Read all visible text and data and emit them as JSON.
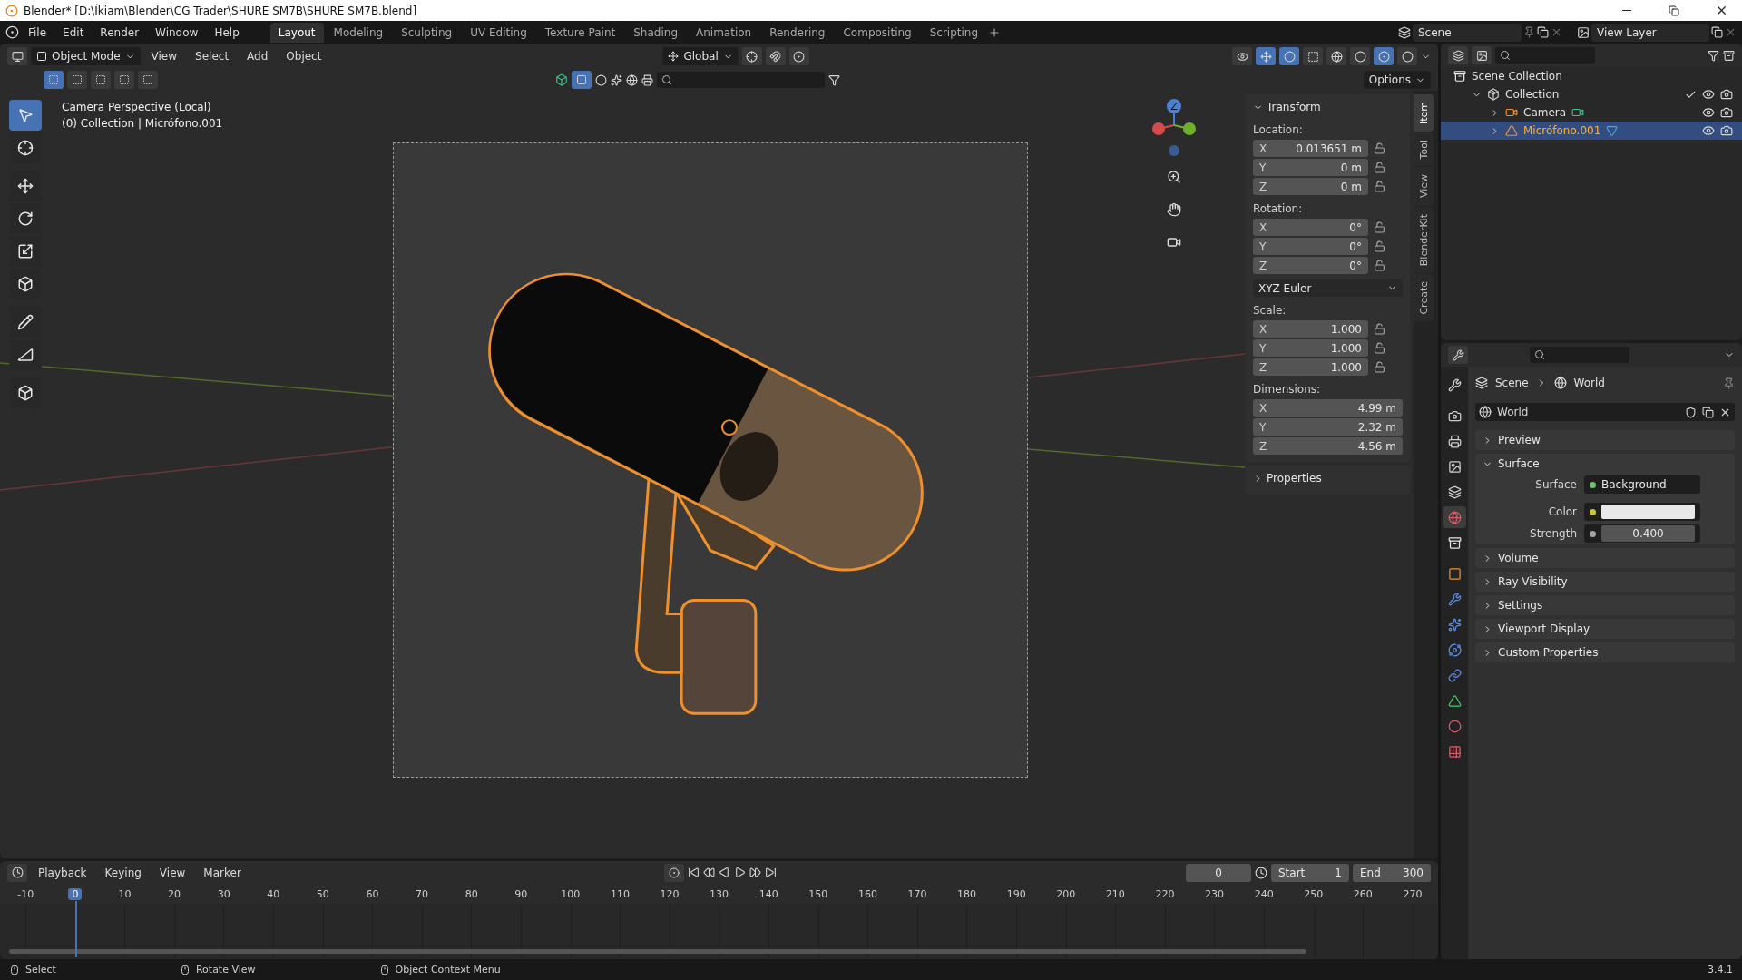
{
  "window": {
    "title": "Blender* [D:\\Íkiam\\Blender\\CG Trader\\SHURE SM7B\\SHURE SM7B.blend]"
  },
  "menu": [
    "File",
    "Edit",
    "Render",
    "Window",
    "Help"
  ],
  "workspaces": [
    {
      "label": "Layout",
      "selected": true
    },
    {
      "label": "Modeling",
      "selected": false
    },
    {
      "label": "Sculpting",
      "selected": false
    },
    {
      "label": "UV Editing",
      "selected": false
    },
    {
      "label": "Texture Paint",
      "selected": false
    },
    {
      "label": "Shading",
      "selected": false
    },
    {
      "label": "Animation",
      "selected": false
    },
    {
      "label": "Rendering",
      "selected": false
    },
    {
      "label": "Compositing",
      "selected": false
    },
    {
      "label": "Scripting",
      "selected": false
    }
  ],
  "scene": {
    "name": "Scene"
  },
  "view_layer": {
    "name": "View Layer"
  },
  "viewport": {
    "mode": "Object Mode",
    "menus": [
      "View",
      "Select",
      "Add",
      "Object"
    ],
    "orientation": "Global",
    "select_modes": [
      {
        "selected": true
      },
      {
        "selected": false
      },
      {
        "selected": false
      },
      {
        "selected": false
      },
      {
        "selected": false
      }
    ],
    "shading": [
      {
        "kind": "wireframe",
        "selected": false
      },
      {
        "kind": "solid",
        "selected": false
      },
      {
        "kind": "material",
        "selected": true
      },
      {
        "kind": "rendered",
        "selected": false
      }
    ],
    "options": "Options",
    "info": [
      "Camera Perspective (Local)",
      "(0) Collection | Micrófono.001"
    ],
    "tools": [
      {
        "kind": "select",
        "selected": true
      },
      {
        "kind": "cursor",
        "selected": false
      },
      {
        "kind": "move",
        "selected": false
      },
      {
        "kind": "rotate",
        "selected": false
      },
      {
        "kind": "scale",
        "selected": false
      },
      {
        "kind": "transform",
        "selected": false
      },
      {
        "kind": "annotate",
        "selected": false
      },
      {
        "kind": "measure",
        "selected": false
      },
      {
        "kind": "add-cube",
        "selected": false
      }
    ],
    "gizmo_label": "Z"
  },
  "sidebar": {
    "tabs": [
      {
        "label": "Item",
        "selected": true
      },
      {
        "label": "Tool",
        "selected": false
      },
      {
        "label": "View",
        "selected": false
      },
      {
        "label": "BlenderKit",
        "selected": false
      },
      {
        "label": "Create",
        "selected": false
      }
    ],
    "panels": [
      {
        "title": "Transform",
        "expanded": true,
        "groups": [
          {
            "kind": "vector",
            "label": "Location:",
            "lockable": true,
            "fields": [
              {
                "axis": "X",
                "value": "0.013651 m"
              },
              {
                "axis": "Y",
                "value": "0 m"
              },
              {
                "axis": "Z",
                "value": "0 m"
              }
            ]
          },
          {
            "kind": "vector",
            "label": "Rotation:",
            "lockable": true,
            "fields": [
              {
                "axis": "X",
                "value": "0°"
              },
              {
                "axis": "Y",
                "value": "0°"
              },
              {
                "axis": "Z",
                "value": "0°"
              }
            ]
          },
          {
            "kind": "dropdown",
            "value": "XYZ Euler"
          },
          {
            "kind": "vector",
            "label": "Scale:",
            "lockable": true,
            "fields": [
              {
                "axis": "X",
                "value": "1.000"
              },
              {
                "axis": "Y",
                "value": "1.000"
              },
              {
                "axis": "Z",
                "value": "1.000"
              }
            ]
          },
          {
            "kind": "vector",
            "label": "Dimensions:",
            "lockable": false,
            "fields": [
              {
                "axis": "X",
                "value": "4.99 m"
              },
              {
                "axis": "Y",
                "value": "2.32 m"
              },
              {
                "axis": "Z",
                "value": "4.56 m"
              }
            ]
          }
        ]
      },
      {
        "title": "Properties",
        "expanded": false
      }
    ]
  },
  "outliner": {
    "items": [
      {
        "label": "Scene Collection",
        "kind": "scene",
        "children": [
          {
            "label": "Collection",
            "kind": "collection",
            "expanded": true,
            "selected": false,
            "checked": true,
            "children": [
              {
                "label": "Camera",
                "kind": "camera",
                "expanded": false,
                "selected": false
              },
              {
                "label": "Micrófono.001",
                "kind": "mesh",
                "expanded": false,
                "selected": true
              }
            ]
          }
        ]
      }
    ]
  },
  "properties": {
    "tabs": [
      {
        "kind": "tool",
        "selected": false
      },
      {
        "kind": "render",
        "selected": false
      },
      {
        "kind": "output",
        "selected": false
      },
      {
        "kind": "view-layer",
        "selected": false
      },
      {
        "kind": "scene",
        "selected": false
      },
      {
        "kind": "world",
        "selected": true
      },
      {
        "kind": "collection",
        "selected": false
      },
      {
        "kind": "object",
        "selected": false
      },
      {
        "kind": "modifiers",
        "selected": false
      },
      {
        "kind": "particles",
        "selected": false
      },
      {
        "kind": "physics",
        "selected": false
      },
      {
        "kind": "constraints",
        "selected": false
      },
      {
        "kind": "data",
        "selected": false
      },
      {
        "kind": "material",
        "selected": false
      },
      {
        "kind": "texture",
        "selected": false
      }
    ],
    "breadcrumb": [
      "Scene",
      "World"
    ],
    "datablock": "World",
    "panels": [
      {
        "label": "Preview",
        "expanded": false
      },
      {
        "label": "Surface",
        "expanded": true,
        "rows": [
          {
            "label": "Surface",
            "kind": "link",
            "value": "Background",
            "color": "#6cc070"
          },
          {
            "label": "Color",
            "kind": "swatch",
            "color": "#c7c73a"
          },
          {
            "label": "Strength",
            "kind": "number",
            "value": "0.400",
            "color": "#a3a3a3"
          }
        ]
      },
      {
        "label": "Volume",
        "expanded": false
      },
      {
        "label": "Ray Visibility",
        "expanded": false
      },
      {
        "label": "Settings",
        "expanded": false
      },
      {
        "label": "Viewport Display",
        "expanded": false
      },
      {
        "label": "Custom Properties",
        "expanded": false
      }
    ]
  },
  "timeline": {
    "menus": [
      "Playback",
      "Keying",
      "View",
      "Marker"
    ],
    "current_frame": "0",
    "start": {
      "label": "Start",
      "value": "1"
    },
    "end": {
      "label": "End",
      "value": "300"
    },
    "ticks": [
      {
        "label": "-10",
        "current": false
      },
      {
        "label": "0",
        "current": true
      },
      {
        "label": "10",
        "current": false
      },
      {
        "label": "20",
        "current": false
      },
      {
        "label": "30",
        "current": false
      },
      {
        "label": "40",
        "current": false
      },
      {
        "label": "50",
        "current": false
      },
      {
        "label": "60",
        "current": false
      },
      {
        "label": "70",
        "current": false
      },
      {
        "label": "80",
        "current": false
      },
      {
        "label": "90",
        "current": false
      },
      {
        "label": "100",
        "current": false
      },
      {
        "label": "110",
        "current": false
      },
      {
        "label": "120",
        "current": false
      },
      {
        "label": "130",
        "current": false
      },
      {
        "label": "140",
        "current": false
      },
      {
        "label": "150",
        "current": false
      },
      {
        "label": "160",
        "current": false
      },
      {
        "label": "170",
        "current": false
      },
      {
        "label": "180",
        "current": false
      },
      {
        "label": "190",
        "current": false
      },
      {
        "label": "200",
        "current": false
      },
      {
        "label": "210",
        "current": false
      },
      {
        "label": "220",
        "current": false
      },
      {
        "label": "230",
        "current": false
      },
      {
        "label": "240",
        "current": false
      },
      {
        "label": "250",
        "current": false
      },
      {
        "label": "260",
        "current": false
      },
      {
        "label": "270",
        "current": false
      }
    ]
  },
  "status_bar": {
    "hints": [
      "Select",
      "Rotate View",
      "Object Context Menu"
    ],
    "version": "3.4.1"
  }
}
